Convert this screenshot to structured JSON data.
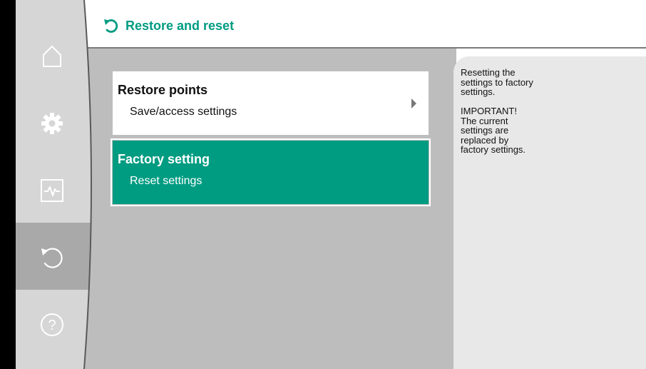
{
  "header": {
    "title": "Restore and reset",
    "icon": "restore-icon"
  },
  "sidebar": {
    "items": [
      {
        "name": "home",
        "icon": "home-icon",
        "active": false
      },
      {
        "name": "settings",
        "icon": "gear-icon",
        "active": false
      },
      {
        "name": "diagnostics",
        "icon": "diagnostics-icon",
        "active": false
      },
      {
        "name": "restore-and-reset",
        "icon": "restore-icon",
        "active": true
      },
      {
        "name": "help",
        "icon": "help-icon",
        "active": false
      }
    ]
  },
  "menu": {
    "items": [
      {
        "title": "Restore points",
        "subtitle": "Save/access settings",
        "selected": false,
        "has_submenu": true
      },
      {
        "title": "Factory setting",
        "subtitle": "Reset settings",
        "selected": true,
        "has_submenu": false
      }
    ]
  },
  "info": {
    "text": "Resetting the\nsettings to factory\nsettings.\n\nIMPORTANT!\nThe current\nsettings are\nreplaced by\nfactory settings."
  },
  "colors": {
    "accent": "#009c82",
    "panel_gray": "#bdbdbd",
    "info_gray": "#e8e8e8",
    "sidebar_gray": "#d6d6d6",
    "sidebar_active": "#a9a9a9",
    "icon_white": "#ffffff"
  }
}
